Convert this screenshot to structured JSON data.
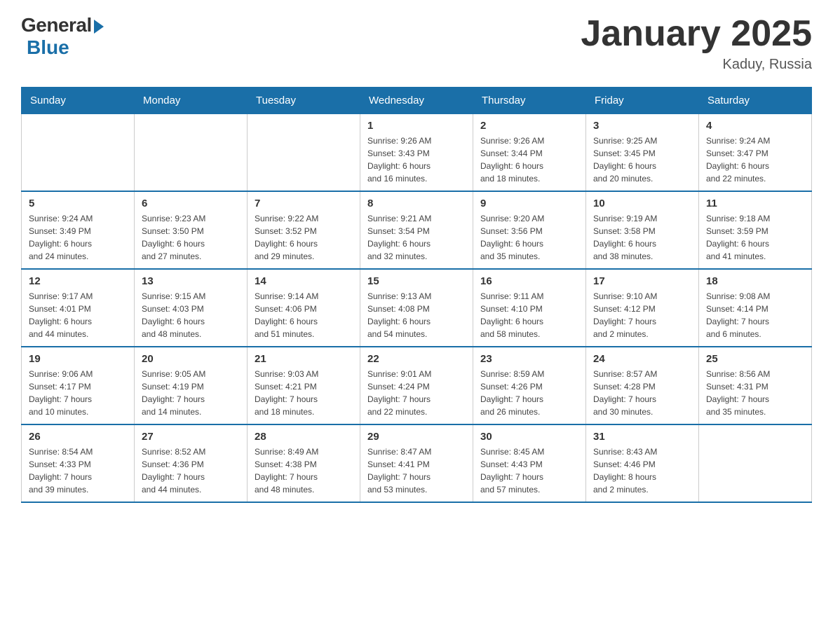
{
  "logo": {
    "general": "General",
    "blue": "Blue"
  },
  "title": "January 2025",
  "subtitle": "Kaduy, Russia",
  "weekdays": [
    "Sunday",
    "Monday",
    "Tuesday",
    "Wednesday",
    "Thursday",
    "Friday",
    "Saturday"
  ],
  "weeks": [
    [
      {
        "day": "",
        "info": ""
      },
      {
        "day": "",
        "info": ""
      },
      {
        "day": "",
        "info": ""
      },
      {
        "day": "1",
        "info": "Sunrise: 9:26 AM\nSunset: 3:43 PM\nDaylight: 6 hours\nand 16 minutes."
      },
      {
        "day": "2",
        "info": "Sunrise: 9:26 AM\nSunset: 3:44 PM\nDaylight: 6 hours\nand 18 minutes."
      },
      {
        "day": "3",
        "info": "Sunrise: 9:25 AM\nSunset: 3:45 PM\nDaylight: 6 hours\nand 20 minutes."
      },
      {
        "day": "4",
        "info": "Sunrise: 9:24 AM\nSunset: 3:47 PM\nDaylight: 6 hours\nand 22 minutes."
      }
    ],
    [
      {
        "day": "5",
        "info": "Sunrise: 9:24 AM\nSunset: 3:49 PM\nDaylight: 6 hours\nand 24 minutes."
      },
      {
        "day": "6",
        "info": "Sunrise: 9:23 AM\nSunset: 3:50 PM\nDaylight: 6 hours\nand 27 minutes."
      },
      {
        "day": "7",
        "info": "Sunrise: 9:22 AM\nSunset: 3:52 PM\nDaylight: 6 hours\nand 29 minutes."
      },
      {
        "day": "8",
        "info": "Sunrise: 9:21 AM\nSunset: 3:54 PM\nDaylight: 6 hours\nand 32 minutes."
      },
      {
        "day": "9",
        "info": "Sunrise: 9:20 AM\nSunset: 3:56 PM\nDaylight: 6 hours\nand 35 minutes."
      },
      {
        "day": "10",
        "info": "Sunrise: 9:19 AM\nSunset: 3:58 PM\nDaylight: 6 hours\nand 38 minutes."
      },
      {
        "day": "11",
        "info": "Sunrise: 9:18 AM\nSunset: 3:59 PM\nDaylight: 6 hours\nand 41 minutes."
      }
    ],
    [
      {
        "day": "12",
        "info": "Sunrise: 9:17 AM\nSunset: 4:01 PM\nDaylight: 6 hours\nand 44 minutes."
      },
      {
        "day": "13",
        "info": "Sunrise: 9:15 AM\nSunset: 4:03 PM\nDaylight: 6 hours\nand 48 minutes."
      },
      {
        "day": "14",
        "info": "Sunrise: 9:14 AM\nSunset: 4:06 PM\nDaylight: 6 hours\nand 51 minutes."
      },
      {
        "day": "15",
        "info": "Sunrise: 9:13 AM\nSunset: 4:08 PM\nDaylight: 6 hours\nand 54 minutes."
      },
      {
        "day": "16",
        "info": "Sunrise: 9:11 AM\nSunset: 4:10 PM\nDaylight: 6 hours\nand 58 minutes."
      },
      {
        "day": "17",
        "info": "Sunrise: 9:10 AM\nSunset: 4:12 PM\nDaylight: 7 hours\nand 2 minutes."
      },
      {
        "day": "18",
        "info": "Sunrise: 9:08 AM\nSunset: 4:14 PM\nDaylight: 7 hours\nand 6 minutes."
      }
    ],
    [
      {
        "day": "19",
        "info": "Sunrise: 9:06 AM\nSunset: 4:17 PM\nDaylight: 7 hours\nand 10 minutes."
      },
      {
        "day": "20",
        "info": "Sunrise: 9:05 AM\nSunset: 4:19 PM\nDaylight: 7 hours\nand 14 minutes."
      },
      {
        "day": "21",
        "info": "Sunrise: 9:03 AM\nSunset: 4:21 PM\nDaylight: 7 hours\nand 18 minutes."
      },
      {
        "day": "22",
        "info": "Sunrise: 9:01 AM\nSunset: 4:24 PM\nDaylight: 7 hours\nand 22 minutes."
      },
      {
        "day": "23",
        "info": "Sunrise: 8:59 AM\nSunset: 4:26 PM\nDaylight: 7 hours\nand 26 minutes."
      },
      {
        "day": "24",
        "info": "Sunrise: 8:57 AM\nSunset: 4:28 PM\nDaylight: 7 hours\nand 30 minutes."
      },
      {
        "day": "25",
        "info": "Sunrise: 8:56 AM\nSunset: 4:31 PM\nDaylight: 7 hours\nand 35 minutes."
      }
    ],
    [
      {
        "day": "26",
        "info": "Sunrise: 8:54 AM\nSunset: 4:33 PM\nDaylight: 7 hours\nand 39 minutes."
      },
      {
        "day": "27",
        "info": "Sunrise: 8:52 AM\nSunset: 4:36 PM\nDaylight: 7 hours\nand 44 minutes."
      },
      {
        "day": "28",
        "info": "Sunrise: 8:49 AM\nSunset: 4:38 PM\nDaylight: 7 hours\nand 48 minutes."
      },
      {
        "day": "29",
        "info": "Sunrise: 8:47 AM\nSunset: 4:41 PM\nDaylight: 7 hours\nand 53 minutes."
      },
      {
        "day": "30",
        "info": "Sunrise: 8:45 AM\nSunset: 4:43 PM\nDaylight: 7 hours\nand 57 minutes."
      },
      {
        "day": "31",
        "info": "Sunrise: 8:43 AM\nSunset: 4:46 PM\nDaylight: 8 hours\nand 2 minutes."
      },
      {
        "day": "",
        "info": ""
      }
    ]
  ]
}
